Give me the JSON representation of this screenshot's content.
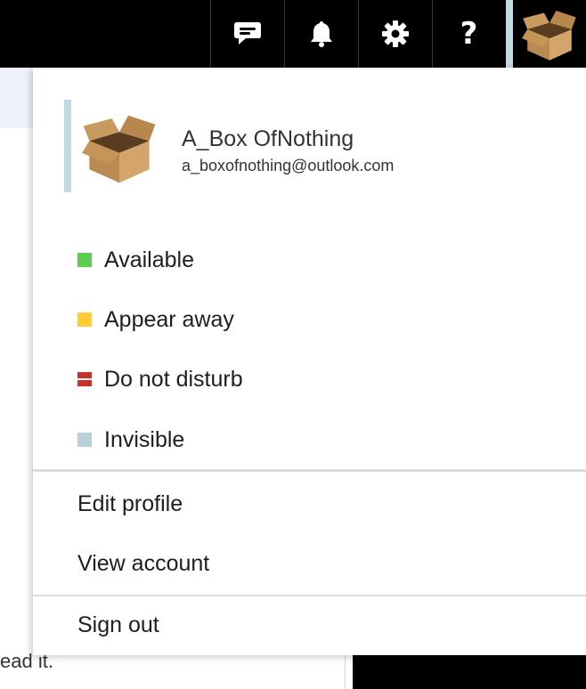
{
  "background": {
    "partial_text": "ead it."
  },
  "topbar": {
    "buttons": [
      {
        "icon": "chat-bubble-icon"
      },
      {
        "icon": "bell-icon"
      },
      {
        "icon": "gear-icon"
      },
      {
        "icon": "help-icon",
        "glyph": "?"
      }
    ],
    "accent": "#c2d9e3"
  },
  "profile": {
    "name": "A_Box OfNothing",
    "email": "a_boxofnothing@outlook.com"
  },
  "status": [
    {
      "label": "Available",
      "color": "#5ccc52"
    },
    {
      "label": "Appear away",
      "color": "#ffcc33"
    },
    {
      "label": "Do not disturb",
      "color": "#c9302c"
    },
    {
      "label": "Invisible",
      "color": "#b8d0da"
    }
  ],
  "menu": {
    "edit_profile": "Edit profile",
    "view_account": "View account",
    "sign_out": "Sign out"
  }
}
